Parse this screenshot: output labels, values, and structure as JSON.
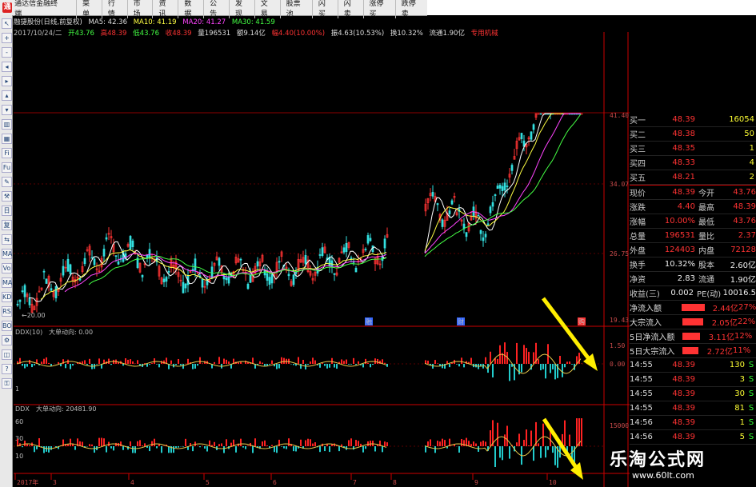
{
  "app": {
    "title": "通达信金融终端",
    "menu": [
      "菜单",
      "行情",
      "市场",
      "资讯",
      "数据",
      "公告",
      "发现",
      "文易",
      "股票池",
      "闪买",
      "闪卖",
      "涨停买",
      "跌停卖"
    ]
  },
  "toolbar": {
    "icons": [
      "cursor-icon",
      "zoom-in-icon",
      "zoom-out-icon",
      "left-icon",
      "right-icon",
      "up-icon",
      "down-icon",
      "chart-icon",
      "kline-icon",
      "indicator-icon",
      "formula-icon",
      "draw-icon",
      "tools-icon",
      "period-icon",
      "fq-icon",
      "sync-icon",
      "ma-icon",
      "vol-icon",
      "macd-icon",
      "kdj-icon",
      "rsi-icon",
      "boll-icon",
      "settings-icon",
      "other-icon",
      "help-icon",
      "lock-icon"
    ],
    "labels": [
      "↖",
      "+",
      "-",
      "◂",
      "▸",
      "▴",
      "▾",
      "▥",
      "▦",
      "Fi",
      "Fu",
      "✎",
      "⚒",
      "日",
      "复",
      "⇆",
      "MA",
      "Vo",
      "MA",
      "KD",
      "RS",
      "BO",
      "⚙",
      "◫",
      "?",
      "⚿"
    ]
  },
  "info": {
    "stock": "融捷股份(日线,前复权)",
    "ma5": "MA5: 42.36",
    "ma10": "MA10: 41.19",
    "ma20": "MA20: 41.27",
    "ma30": "MA30: 41.59",
    "date": "2017/10/24/二",
    "open": "开43.76",
    "high": "高48.39",
    "low": "低43.76",
    "close": "收48.39",
    "volume": "量196531",
    "amount": "额9.14亿",
    "change": "幅4.40(10.00%)",
    "amplitude": "振4.63(10.53%)",
    "turnover": "换10.32%",
    "float": "流通1.90亿",
    "industry": "专用机械"
  },
  "chart_data": {
    "type": "candlestick",
    "price_axis": {
      "ticks": [
        "41.40",
        "34.07",
        "26.75",
        "19.43"
      ]
    },
    "low_marker": "20.00",
    "event_marks": [
      "融",
      "财",
      "购"
    ],
    "sub1": {
      "title": "DDX(10)",
      "label": "大单动向: 0.00",
      "ticks": [
        "1.50",
        "0.00"
      ],
      "left_ticks": [
        "1"
      ]
    },
    "sub2": {
      "title": "DDX",
      "label": "大单动向: 20481.90",
      "ticks": [
        "15000"
      ],
      "left_ticks": [
        "60",
        "30",
        "10"
      ]
    },
    "time_axis": [
      "2017年",
      "3",
      "4",
      "5",
      "6",
      "7",
      "8",
      "9",
      "10"
    ]
  },
  "right_panel": {
    "top_partial": "买一",
    "bids": [
      {
        "l": "买一",
        "p": "48.39",
        "v": "16054"
      },
      {
        "l": "买二",
        "p": "48.38",
        "v": "50"
      },
      {
        "l": "买三",
        "p": "48.35",
        "v": "1"
      },
      {
        "l": "买四",
        "p": "48.33",
        "v": "4"
      },
      {
        "l": "买五",
        "p": "48.21",
        "v": "2"
      }
    ],
    "quote": [
      {
        "a": "现价",
        "av": "48.39",
        "b": "今开",
        "bv": "43.76"
      },
      {
        "a": "涨跌",
        "av": "4.40",
        "b": "最高",
        "bv": "48.39"
      },
      {
        "a": "涨幅",
        "av": "10.00%",
        "b": "最低",
        "bv": "43.76"
      },
      {
        "a": "总量",
        "av": "196531",
        "b": "量比",
        "bv": "2.37"
      },
      {
        "a": "外盘",
        "av": "124403",
        "b": "内盘",
        "bv": "72128"
      }
    ],
    "fund": [
      {
        "a": "换手",
        "av": "10.32%",
        "b": "股本",
        "bv": "2.60亿"
      },
      {
        "a": "净资",
        "av": "2.83",
        "b": "流通",
        "bv": "1.90亿"
      },
      {
        "a": "收益(三)",
        "av": "0.002",
        "b": "PE(动)",
        "bv": "10016.5"
      }
    ],
    "flow": [
      {
        "l": "净流入额",
        "v": "2.44亿",
        "p": "27%"
      },
      {
        "l": "大宗流入",
        "v": "2.05亿",
        "p": "22%"
      },
      {
        "l": "5日净流入额",
        "v": "3.11亿",
        "p": "12%"
      },
      {
        "l": "5日大宗流入",
        "v": "2.72亿",
        "p": "11%"
      }
    ],
    "ticks": [
      {
        "t": "14:55",
        "p": "48.39",
        "v": "130",
        "s": "S"
      },
      {
        "t": "14:55",
        "p": "48.39",
        "v": "3",
        "s": "S"
      },
      {
        "t": "14:55",
        "p": "48.39",
        "v": "30",
        "s": "S"
      },
      {
        "t": "14:55",
        "p": "48.39",
        "v": "81",
        "s": "S"
      },
      {
        "t": "14:56",
        "p": "48.39",
        "v": "1",
        "s": "S"
      },
      {
        "t": "14:56",
        "p": "48.39",
        "v": "5",
        "s": "S"
      }
    ]
  },
  "watermark": {
    "title": "乐淘公式网",
    "url": "www.60lt.com"
  }
}
